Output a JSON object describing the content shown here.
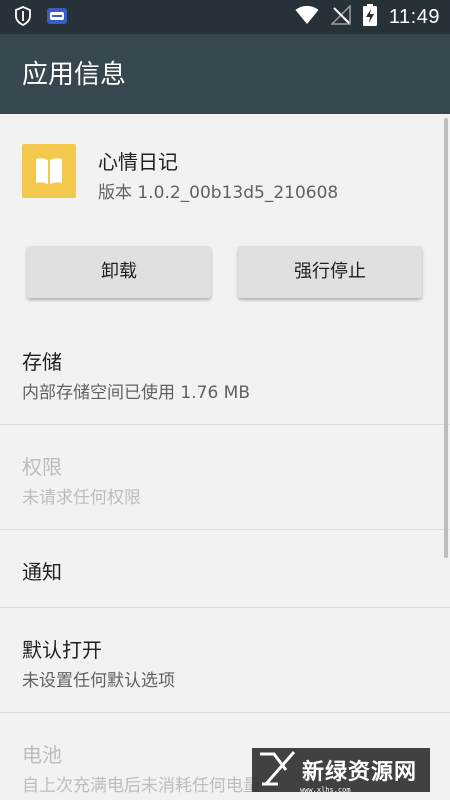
{
  "status_bar": {
    "time": "11:49",
    "left_icons": [
      "shield-icon",
      "game-controller-icon"
    ],
    "right_icons": [
      "wifi-icon",
      "no-signal-icon",
      "battery-charging-icon"
    ]
  },
  "toolbar": {
    "title": "应用信息"
  },
  "app": {
    "name": "心情日记",
    "version": "版本 1.0.2_00b13d5_210608",
    "icon_color": "#f2c94c"
  },
  "buttons": {
    "uninstall": "卸载",
    "force_stop": "强行停止"
  },
  "settings": {
    "storage": {
      "title": "存储",
      "summary": "内部存储空间已使用 1.76 MB"
    },
    "permissions": {
      "title": "权限",
      "summary": "未请求任何权限"
    },
    "notifications": {
      "title": "通知"
    },
    "open_by_default": {
      "title": "默认打开",
      "summary": "未设置任何默认选项"
    },
    "battery": {
      "title": "电池",
      "summary": "自上次充满电后未消耗任何电量"
    }
  },
  "watermark": {
    "text": "新绿资源网",
    "sub": "www.xlhs.com"
  },
  "colors": {
    "status_bar": "#263238",
    "toolbar": "#37474f",
    "background": "#f2f2f2"
  }
}
